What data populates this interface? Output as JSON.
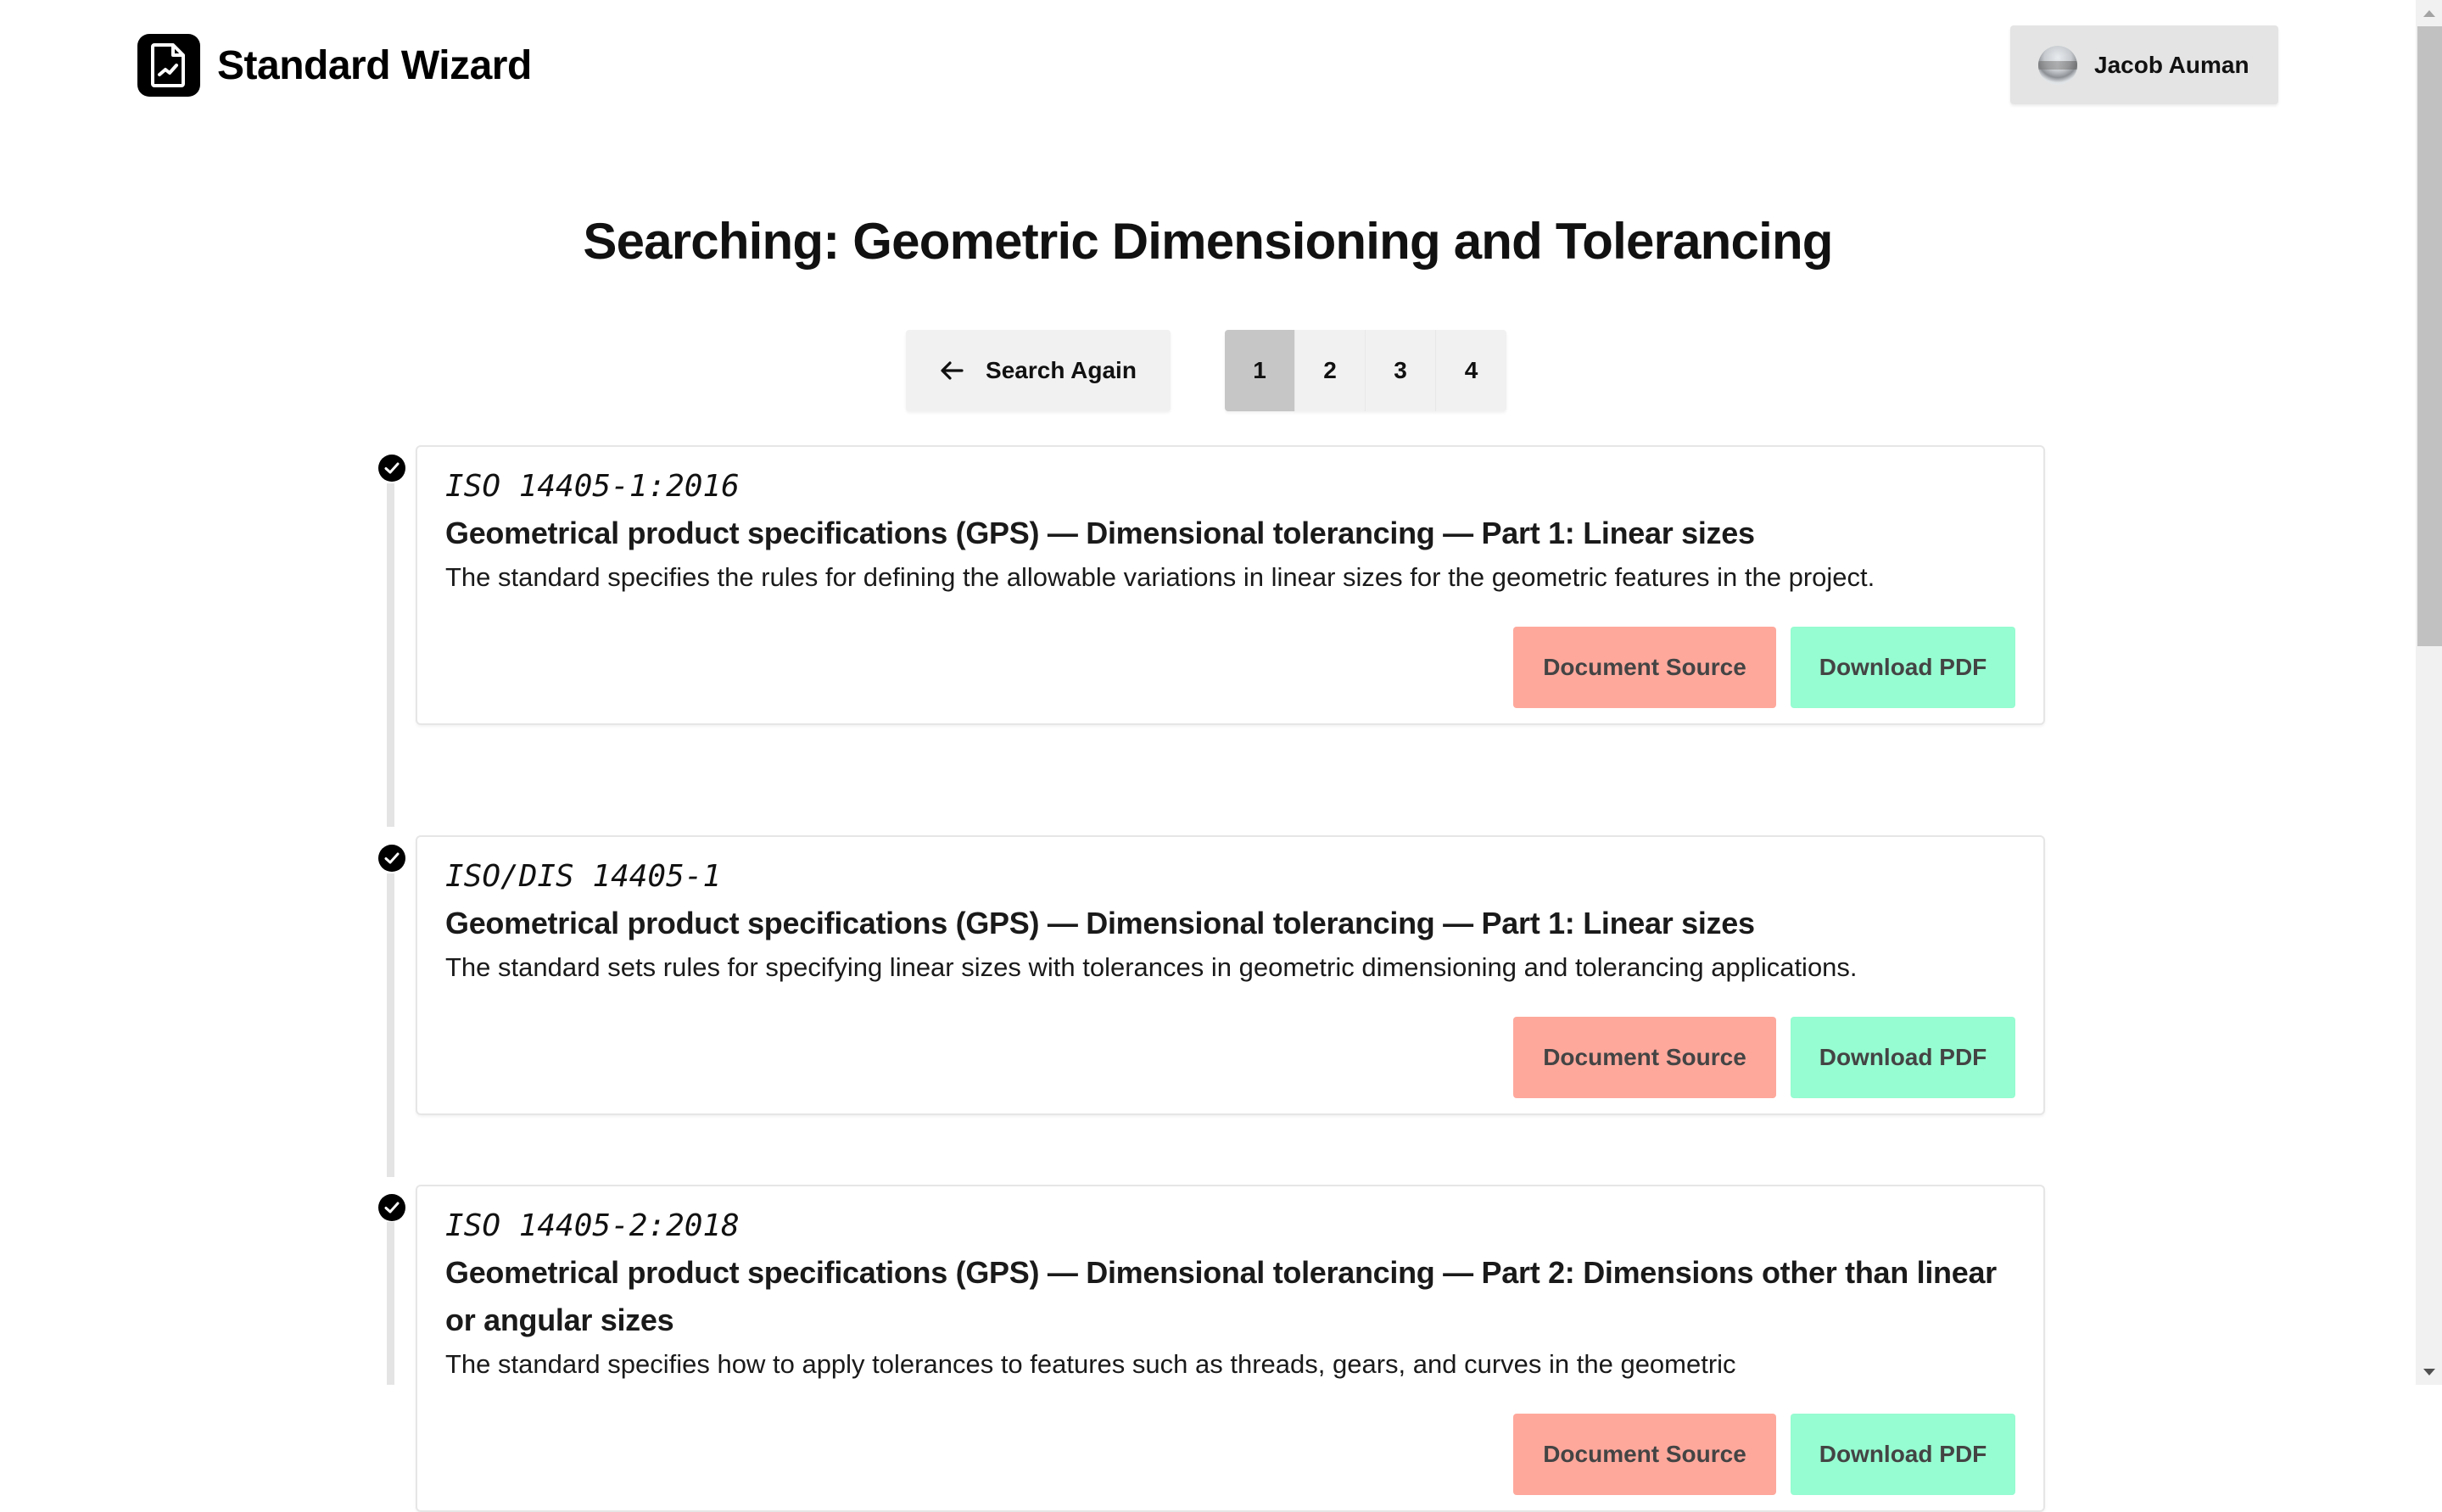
{
  "app": {
    "title": "Standard Wizard",
    "logo_icon": "document-chart-icon"
  },
  "user": {
    "name": "Jacob Auman",
    "avatar_icon": "user-avatar"
  },
  "page": {
    "title": "Searching: Geometric Dimensioning and Tolerancing"
  },
  "controls": {
    "search_again_label": "Search Again",
    "search_again_icon": "arrow-left-icon",
    "pages": [
      "1",
      "2",
      "3",
      "4"
    ],
    "current_page": "1"
  },
  "results": [
    {
      "code": "ISO 14405-1:2016",
      "title": "Geometrical product specifications (GPS) — Dimensional tolerancing — Part 1: Linear sizes",
      "description": "The standard specifies the rules for defining the allowable variations in linear sizes for the geometric features in the project.",
      "source_label": "Document Source",
      "pdf_label": "Download PDF",
      "status_icon": "check-circle-icon"
    },
    {
      "code": "ISO/DIS 14405-1",
      "title": "Geometrical product specifications (GPS) — Dimensional tolerancing — Part 1: Linear sizes",
      "description": "The standard sets rules for specifying linear sizes with tolerances in geometric dimensioning and tolerancing applications.",
      "source_label": "Document Source",
      "pdf_label": "Download PDF",
      "status_icon": "check-circle-icon"
    },
    {
      "code": "ISO 14405-2:2018",
      "title": "Geometrical product specifications (GPS) — Dimensional tolerancing — Part 2: Dimensions other than linear or angular sizes",
      "description": "The standard specifies how to apply tolerances to features such as threads, gears, and curves in the geometric",
      "source_label": "Document Source",
      "pdf_label": "Download PDF",
      "status_icon": "check-circle-icon"
    }
  ],
  "colors": {
    "source_button": "#fea89c",
    "pdf_button": "#96fcd1",
    "active_page": "#c6c6c6",
    "button_bg": "#f1f1f1"
  }
}
